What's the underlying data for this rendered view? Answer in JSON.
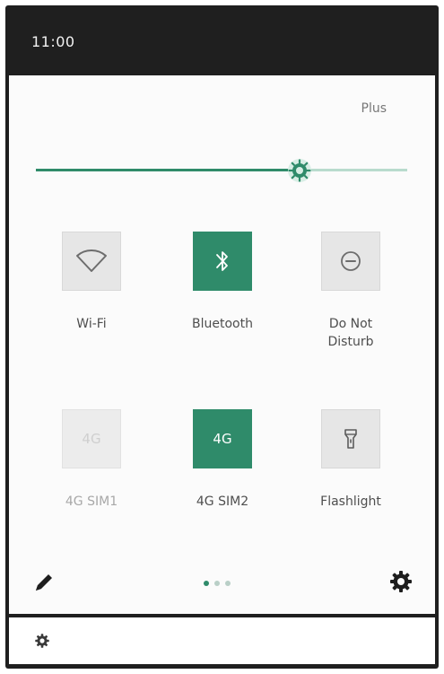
{
  "status_bar": {
    "time": "11:00"
  },
  "quick_settings": {
    "carrier": "Plus",
    "brightness_level": 0.71,
    "tiles": [
      {
        "label": "Wi-Fi",
        "state": "off",
        "icon": "wifi-icon"
      },
      {
        "label": "Bluetooth",
        "state": "on",
        "icon": "bluetooth-icon"
      },
      {
        "label": "Do Not\nDisturb",
        "state": "off",
        "icon": "do-not-disturb-icon"
      },
      {
        "label": "4G SIM1",
        "state": "disabled",
        "icon": "4g-icon",
        "icon_text": "4G"
      },
      {
        "label": "4G SIM2",
        "state": "on",
        "icon": "4g-icon",
        "icon_text": "4G"
      },
      {
        "label": "Flashlight",
        "state": "off",
        "icon": "flashlight-icon"
      }
    ],
    "page_indicator": {
      "pages": 3,
      "current": 1
    }
  },
  "colors": {
    "accent": "#2f8b6a",
    "track": "#b8dbcd",
    "tile_off": "#e6e6e6",
    "status_bar": "#1f1f1f"
  }
}
